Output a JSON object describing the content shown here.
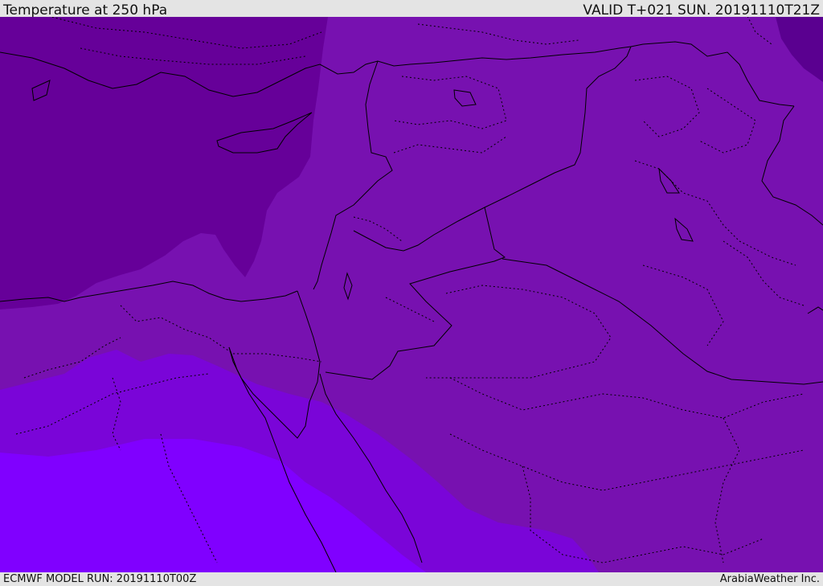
{
  "header": {
    "title": "Temperature at 250 hPa",
    "valid": "VALID T+021 SUN. 20191110T21Z"
  },
  "footer": {
    "model_run": "ECMWF MODEL RUN: 20191110T00Z",
    "credit": "ArabiaWeather Inc."
  },
  "map": {
    "colors": {
      "band_coldest": "#660099",
      "band_cold": "#7711b0",
      "band_mid": "#7a05d8",
      "band_warm": "#8000ff",
      "corner_dark": "#5a0090",
      "boundary_line": "#000000"
    }
  }
}
